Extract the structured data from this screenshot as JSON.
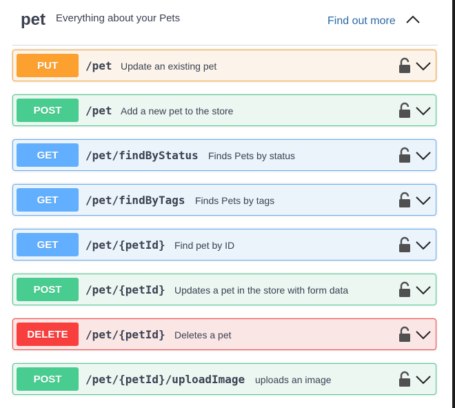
{
  "tag": {
    "name": "pet",
    "description": "Everything about your Pets",
    "link_label": "Find out more",
    "toggle_icon": "chevron-up-icon"
  },
  "operations": [
    {
      "method": "PUT",
      "path": "/pet",
      "summary": "Update an existing pet",
      "kind": "put"
    },
    {
      "method": "POST",
      "path": "/pet",
      "summary": "Add a new pet to the store",
      "kind": "post"
    },
    {
      "method": "GET",
      "path": "/pet/findByStatus",
      "summary": "Finds Pets by status",
      "kind": "get"
    },
    {
      "method": "GET",
      "path": "/pet/findByTags",
      "summary": "Finds Pets by tags",
      "kind": "get"
    },
    {
      "method": "GET",
      "path": "/pet/{petId}",
      "summary": "Find pet by ID",
      "kind": "get"
    },
    {
      "method": "POST",
      "path": "/pet/{petId}",
      "summary": "Updates a pet in the store with form data",
      "kind": "post"
    },
    {
      "method": "DELETE",
      "path": "/pet/{petId}",
      "summary": "Deletes a pet",
      "kind": "delete"
    },
    {
      "method": "POST",
      "path": "/pet/{petId}/uploadImage",
      "summary": "uploads an image",
      "kind": "post"
    }
  ],
  "icons": {
    "lock": "lock-icon",
    "expand": "chevron-down-icon"
  },
  "colors": {
    "put": "#fca130",
    "post": "#49cc90",
    "get": "#61affe",
    "delete": "#f93e3e",
    "link": "#2a69a8",
    "text": "#3b4151"
  }
}
